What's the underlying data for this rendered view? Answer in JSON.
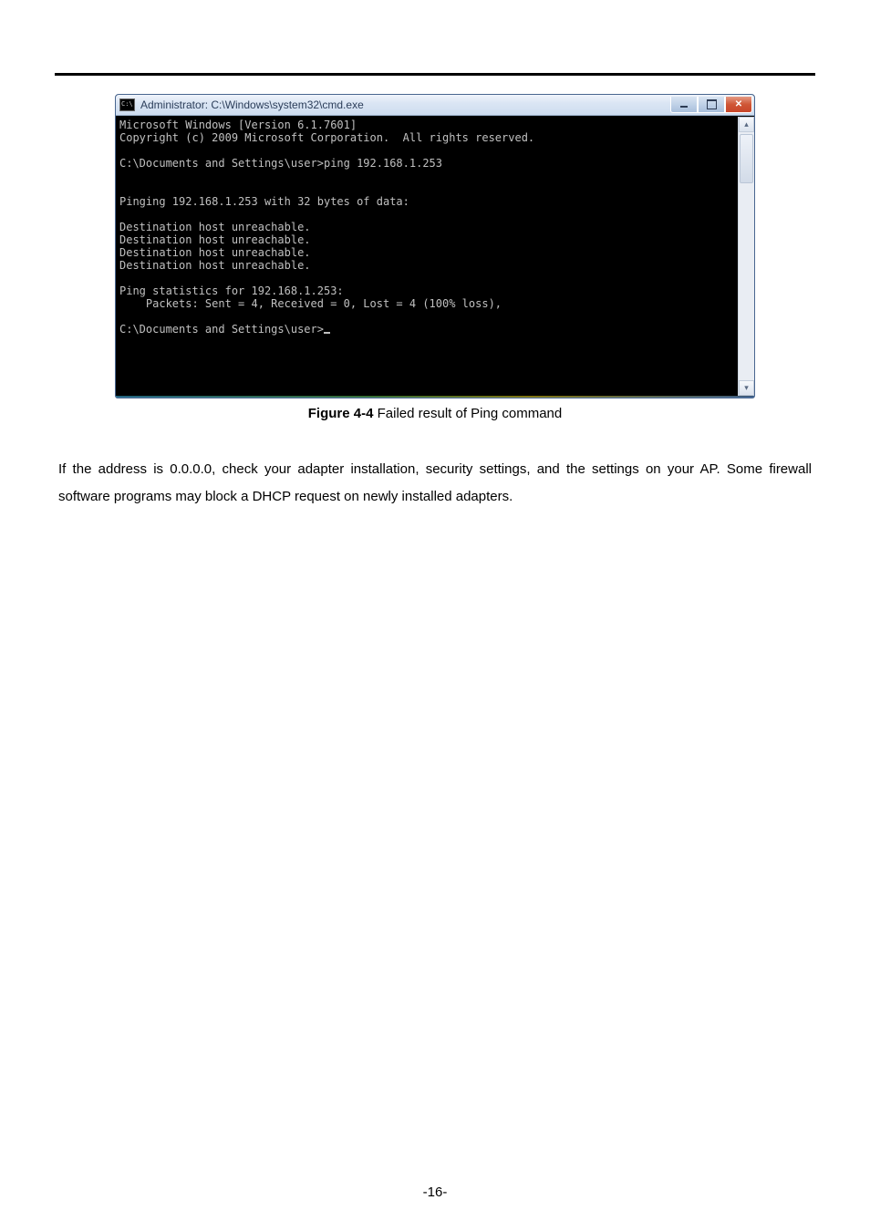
{
  "window": {
    "title": "Administrator: C:\\Windows\\system32\\cmd.exe",
    "icon_glyph": "C:\\",
    "buttons": {
      "minimize_name": "minimize-button",
      "maximize_name": "maximize-button",
      "close_name": "close-button"
    }
  },
  "terminal": {
    "line01": "Microsoft Windows [Version 6.1.7601]",
    "line02": "Copyright (c) 2009 Microsoft Corporation.  All rights reserved.",
    "line03": "",
    "line04": "C:\\Documents and Settings\\user>ping 192.168.1.253",
    "line05": "",
    "line06": "",
    "line07": "Pinging 192.168.1.253 with 32 bytes of data:",
    "line08": "",
    "line09": "Destination host unreachable.",
    "line10": "Destination host unreachable.",
    "line11": "Destination host unreachable.",
    "line12": "Destination host unreachable.",
    "line13": "",
    "line14": "Ping statistics for 192.168.1.253:",
    "line15": "    Packets: Sent = 4, Received = 0, Lost = 4 (100% loss),",
    "line16": "",
    "line17": "C:\\Documents and Settings\\user>"
  },
  "caption": {
    "label": "Figure 4-4",
    "text": " Failed result of Ping command"
  },
  "paragraph": "If the address is 0.0.0.0, check your adapter installation, security settings, and the settings on your AP. Some firewall software programs may block a DHCP request on newly installed adapters.",
  "page_number": "-16-"
}
